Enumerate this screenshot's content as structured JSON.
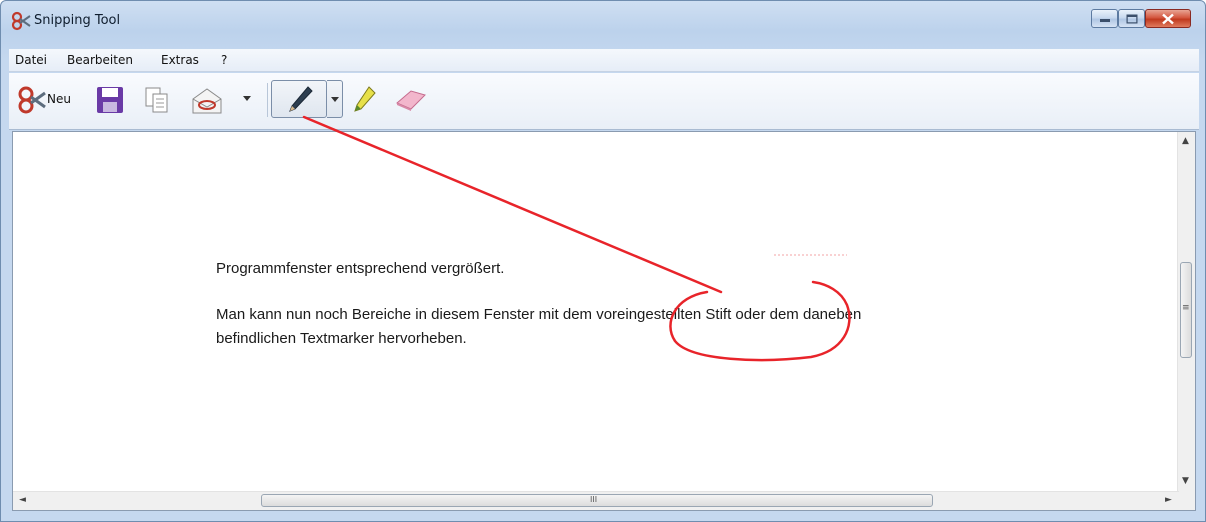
{
  "window": {
    "title": "Snipping Tool"
  },
  "menu": {
    "items": [
      "Datei",
      "Bearbeiten",
      "Extras",
      "?"
    ]
  },
  "toolbar": {
    "new_label": "Neu"
  },
  "content": {
    "line1": "Programmfenster entsprechend vergrößert.",
    "line2": "Man kann nun noch Bereiche in diesem Fenster mit dem voreingestellten Stift oder dem daneben",
    "line3": "befindlichen Textmarker hervorheben."
  },
  "scrollbar": {
    "h_grip": "III",
    "v_grip": "≡"
  },
  "colors": {
    "annotation": "#e8242a",
    "title_bg": "#c9dbf0"
  }
}
